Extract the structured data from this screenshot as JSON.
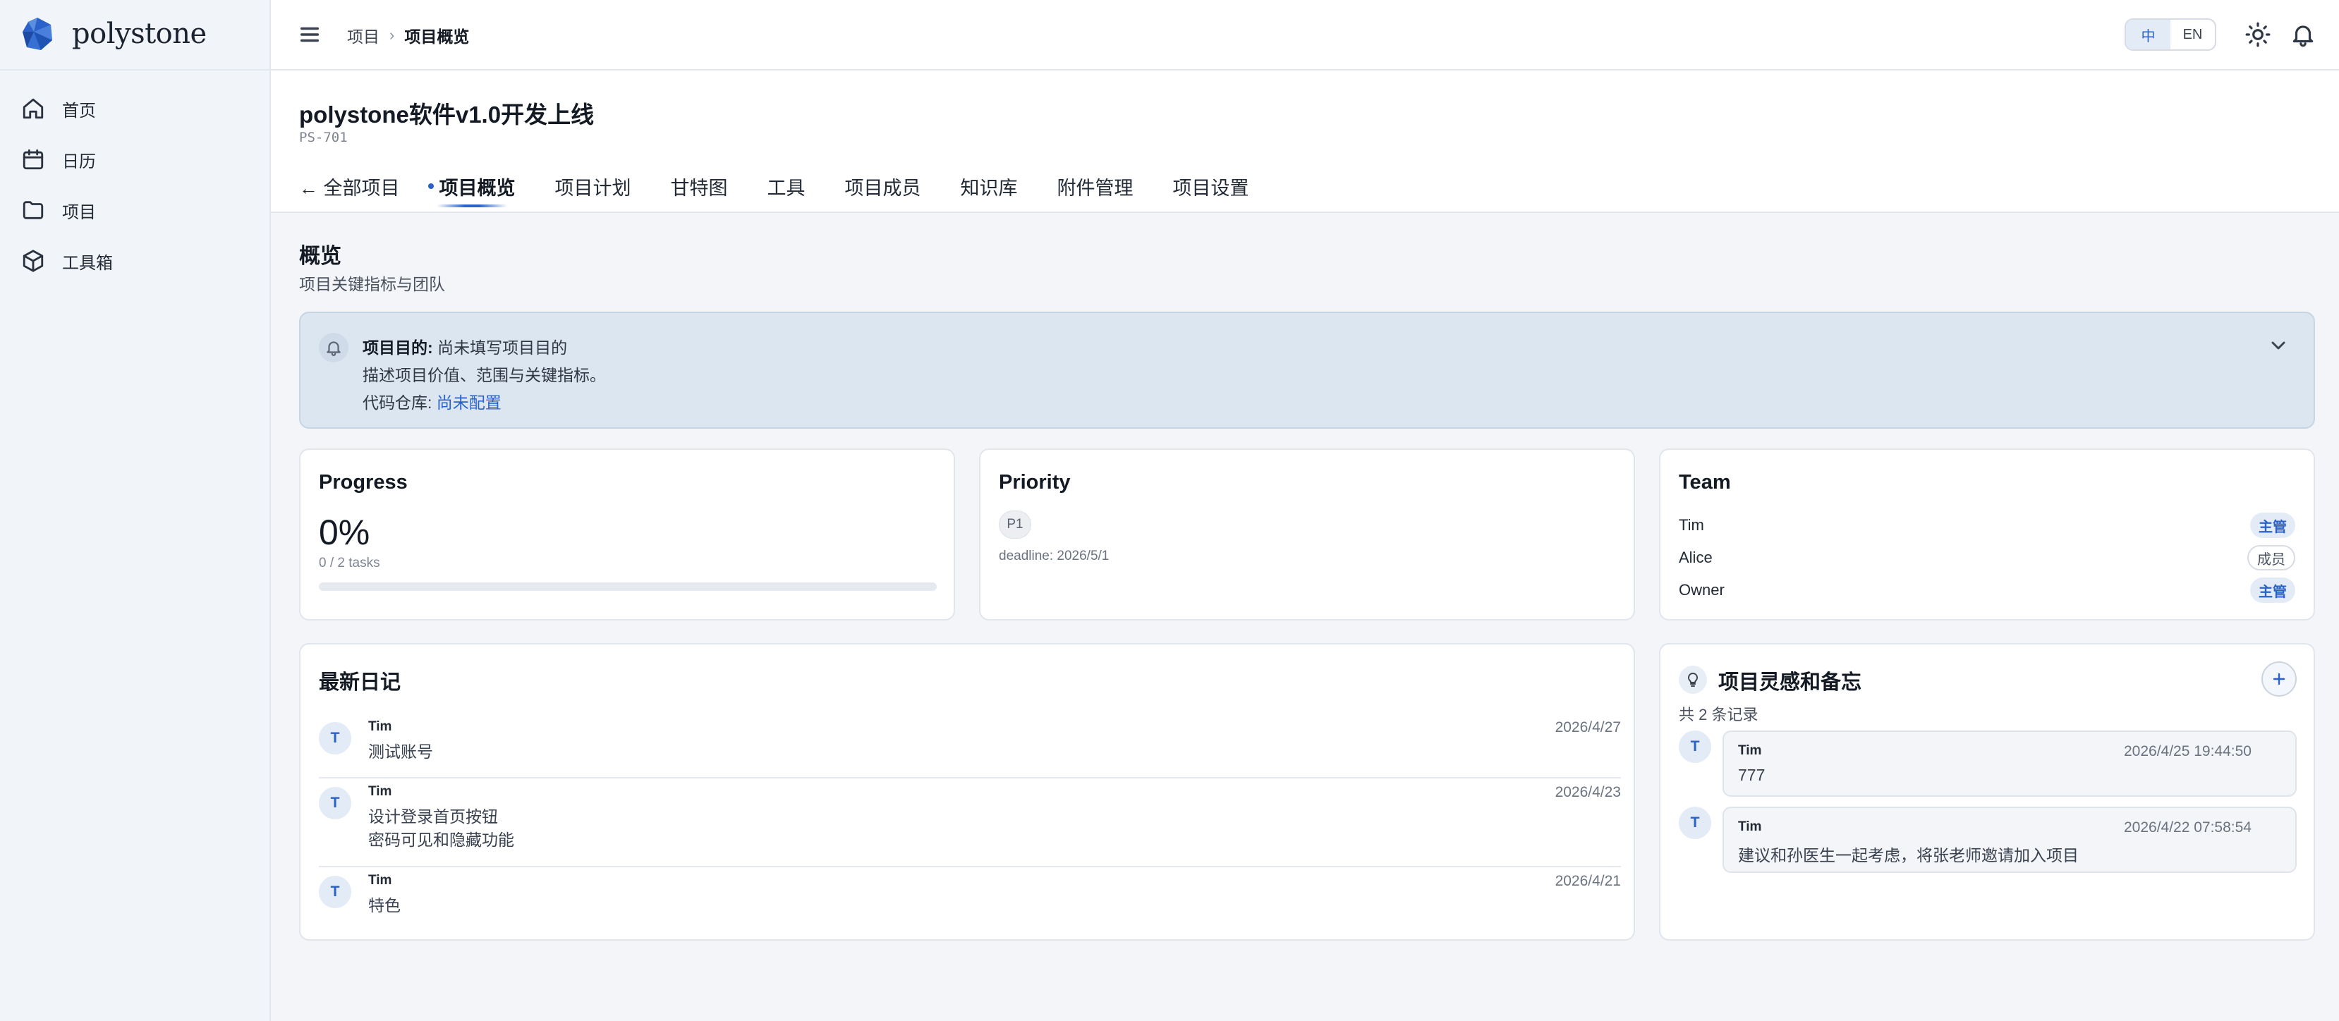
{
  "app": {
    "brand": "polystone",
    "accent_color": "#2a62c9"
  },
  "sidebar": {
    "items": [
      {
        "label": "首页",
        "icon": "home-icon"
      },
      {
        "label": "日历",
        "icon": "calendar-icon"
      },
      {
        "label": "项目",
        "icon": "folder-icon"
      },
      {
        "label": "工具箱",
        "icon": "box-icon"
      }
    ]
  },
  "topbar": {
    "breadcrumb": [
      "项目",
      "项目概览"
    ],
    "lang": {
      "zh": "中",
      "en": "EN",
      "active": "zh"
    },
    "icons": [
      "menu-icon",
      "sun-icon",
      "bell-icon"
    ]
  },
  "project": {
    "title": "polystone软件v1.0开发上线",
    "code": "PS-701",
    "tabs": [
      {
        "label": "← 全部项目"
      },
      {
        "label": "项目概览",
        "active": true
      },
      {
        "label": "项目计划"
      },
      {
        "label": "甘特图"
      },
      {
        "label": "工具"
      },
      {
        "label": "项目成员"
      },
      {
        "label": "知识库"
      },
      {
        "label": "附件管理"
      },
      {
        "label": "项目设置"
      }
    ]
  },
  "overview": {
    "title": "概览",
    "subtitle": "项目关键指标与团队"
  },
  "alert": {
    "purpose_label": "项目目的:",
    "purpose_value": "尚未填写项目目的",
    "description": "描述项目价值、范围与关键指标。",
    "repo_label": "代码仓库:",
    "repo_value": "尚未配置"
  },
  "progress": {
    "title": "Progress",
    "value_text": "0%",
    "fraction": 0,
    "tasks": "0 / 2 tasks"
  },
  "priority": {
    "title": "Priority",
    "badge": "P1",
    "deadline": "deadline: 2026/5/1"
  },
  "team": {
    "title": "Team",
    "members": [
      {
        "name": "Tim",
        "role": "主管",
        "role_type": "lead"
      },
      {
        "name": "Alice",
        "role": "成员",
        "role_type": "member"
      },
      {
        "name": "Owner",
        "role": "主管",
        "role_type": "lead"
      }
    ]
  },
  "diary": {
    "title": "最新日记",
    "entries": [
      {
        "avatar": "T",
        "author": "Tim",
        "date": "2026/4/27",
        "lines": [
          "测试账号"
        ]
      },
      {
        "avatar": "T",
        "author": "Tim",
        "date": "2026/4/23",
        "lines": [
          "设计登录首页按钮",
          "密码可见和隐藏功能"
        ]
      },
      {
        "avatar": "T",
        "author": "Tim",
        "date": "2026/4/21",
        "lines": [
          "特色"
        ]
      }
    ]
  },
  "memos": {
    "title": "项目灵感和备忘",
    "count": "共 2 条记录",
    "items": [
      {
        "avatar": "T",
        "author": "Tim",
        "time": "2026/4/25 19:44:50",
        "text": "777"
      },
      {
        "avatar": "T",
        "author": "Tim",
        "time": "2026/4/22 07:58:54",
        "text": "建议和孙医生一起考虑，将张老师邀请加入项目"
      }
    ]
  }
}
